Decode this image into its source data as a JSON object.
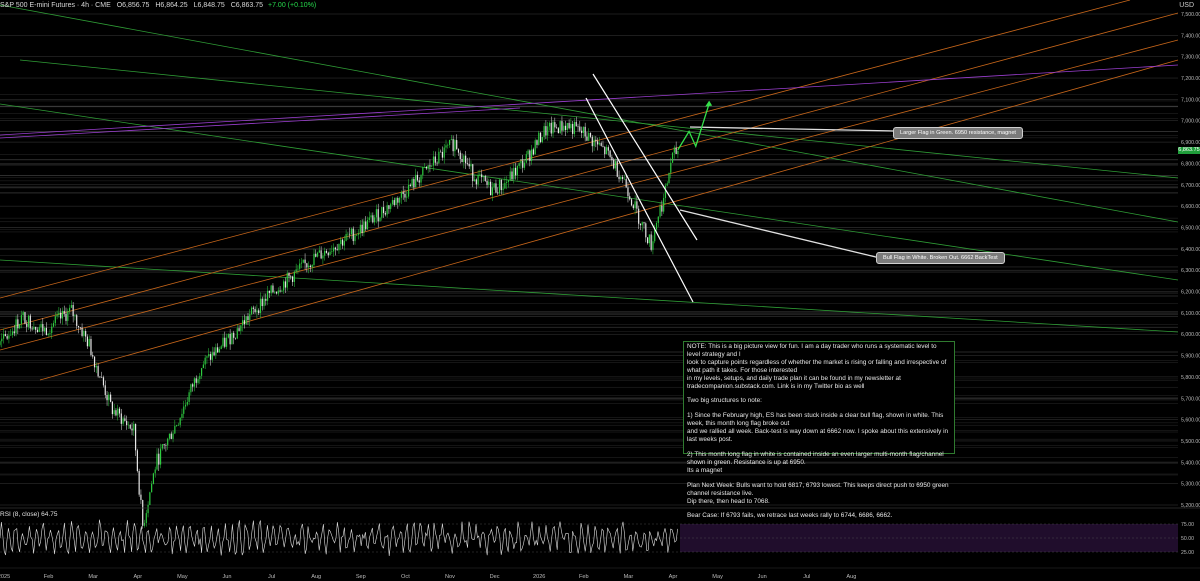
{
  "header": {
    "symbol": "S&P 500 E-mini Futures · 4h · CME",
    "open": "O6,856.75",
    "high": "H6,864.25",
    "low": "L6,848.75",
    "close": "C6,863.75",
    "change": "+7.00 (+0.10%)",
    "currency": "USD"
  },
  "price_tag": "6,863.75",
  "callouts": {
    "green_flag": "Larger Flag in Green. 6950 resistance, magnet",
    "white_flag": "Bull Flag in White. Broken Out. 6662 BackTest"
  },
  "note": {
    "paragraphs": [
      "NOTE: This is a big picture view for fun. I am a day trader who runs a systematic level to level strategy and I\nlook to capture points regardless of whether the market is rising or falling and irrespective of what path it takes. For those interested\nin my levels, setups, and daily trade plan it can be found in my newsletter at tradecompanion.substack.com. Link is in my Twitter bio as well",
      "Two big structures to note:",
      "1) Since the February high, ES has been stuck inside a clear bull flag, shown in white. This week, this month long flag broke out\nand we rallied all week. Back-test is way down at 6662 now. I spoke about this extensively in last weeks post.",
      "2) This month long flag in white is contained inside an even larger multi-month flag/channel shown in green. Resistance is up at 6950.\nIts a magnet",
      "Plan Next Week: Bulls want to hold 6817, 6793 lowest. This keeps direct push to 6950 green channel resistance live.\nDip there, then head to 7068.",
      "Bear Case: If 6793 fails, we retrace last weeks rally to 6744, 6686, 6662."
    ]
  },
  "rsi_label": "RSI (8, close) 64.75",
  "colors": {
    "background": "#000000",
    "candle_up": "#2ecc40",
    "candle_down": "#e8e8e8",
    "green_channel": "#2f9d36",
    "orange_channel": "#c7661a",
    "purple_line": "#9b3fd0",
    "white_flag": "#ffffff",
    "rsi_line": "#e0e0e0",
    "rsi_band": "#3a1850",
    "level_lines": "#2a2a2a"
  },
  "chart_data": {
    "type": "candlestick",
    "timeframe": "4h",
    "ylim": [
      5200,
      7500
    ],
    "y_ticks": [
      "7,500.00",
      "7,400.00",
      "7,300.00",
      "7,200.00",
      "7,100.00",
      "7,000.00",
      "6,900.00",
      "6,800.00",
      "6,700.00",
      "6,600.00",
      "6,500.00",
      "6,400.00",
      "6,300.00",
      "6,200.00",
      "6,100.00",
      "6,000.00",
      "5,900.00",
      "5,800.00",
      "5,700.00",
      "5,600.00",
      "5,500.00",
      "5,400.00",
      "5,300.00",
      "5,200.00"
    ],
    "x_ticks": [
      "2025",
      "Feb",
      "Mar",
      "Apr",
      "May",
      "Jun",
      "Jul",
      "Aug",
      "Sep",
      "Oct",
      "Nov",
      "Dec",
      "2026",
      "Feb",
      "Mar",
      "Apr",
      "May",
      "Jun",
      "Jul",
      "Aug"
    ],
    "price_path": [
      {
        "m": 0.0,
        "p": 5950
      },
      {
        "m": 0.5,
        "p": 6080
      },
      {
        "m": 1.0,
        "p": 6020
      },
      {
        "m": 1.6,
        "p": 6110
      },
      {
        "m": 2.0,
        "p": 5950
      },
      {
        "m": 2.5,
        "p": 5650
      },
      {
        "m": 3.0,
        "p": 5550
      },
      {
        "m": 3.2,
        "p": 5100
      },
      {
        "m": 3.5,
        "p": 5400
      },
      {
        "m": 4.0,
        "p": 5600
      },
      {
        "m": 4.5,
        "p": 5850
      },
      {
        "m": 5.0,
        "p": 5950
      },
      {
        "m": 6.0,
        "p": 6180
      },
      {
        "m": 7.0,
        "p": 6350
      },
      {
        "m": 8.0,
        "p": 6480
      },
      {
        "m": 9.0,
        "p": 6650
      },
      {
        "m": 9.8,
        "p": 6820
      },
      {
        "m": 10.2,
        "p": 6900
      },
      {
        "m": 10.6,
        "p": 6750
      },
      {
        "m": 11.0,
        "p": 6680
      },
      {
        "m": 11.3,
        "p": 6700
      },
      {
        "m": 11.8,
        "p": 6820
      },
      {
        "m": 12.2,
        "p": 6950
      },
      {
        "m": 12.7,
        "p": 6980
      },
      {
        "m": 13.1,
        "p": 6940
      },
      {
        "m": 13.6,
        "p": 6850
      },
      {
        "m": 14.0,
        "p": 6720
      },
      {
        "m": 14.3,
        "p": 6560
      },
      {
        "m": 14.6,
        "p": 6420
      },
      {
        "m": 14.75,
        "p": 6560
      },
      {
        "m": 14.9,
        "p": 6640
      },
      {
        "m": 15.05,
        "p": 6820
      },
      {
        "m": 15.2,
        "p": 6864
      }
    ],
    "rsi": {
      "period": 8,
      "value": 64.75,
      "levels": [
        75,
        50,
        25
      ],
      "tick_labels": [
        "75.00",
        "50.00",
        "25.00"
      ]
    },
    "annotations": {
      "levels": [
        6950,
        7068,
        6817,
        6793,
        6744,
        6686,
        6662
      ],
      "projected_path": [
        {
          "m": 15.2,
          "p": 6864
        },
        {
          "m": 15.45,
          "p": 6950
        },
        {
          "m": 15.6,
          "p": 6880
        },
        {
          "m": 15.9,
          "p": 7080
        }
      ]
    }
  }
}
